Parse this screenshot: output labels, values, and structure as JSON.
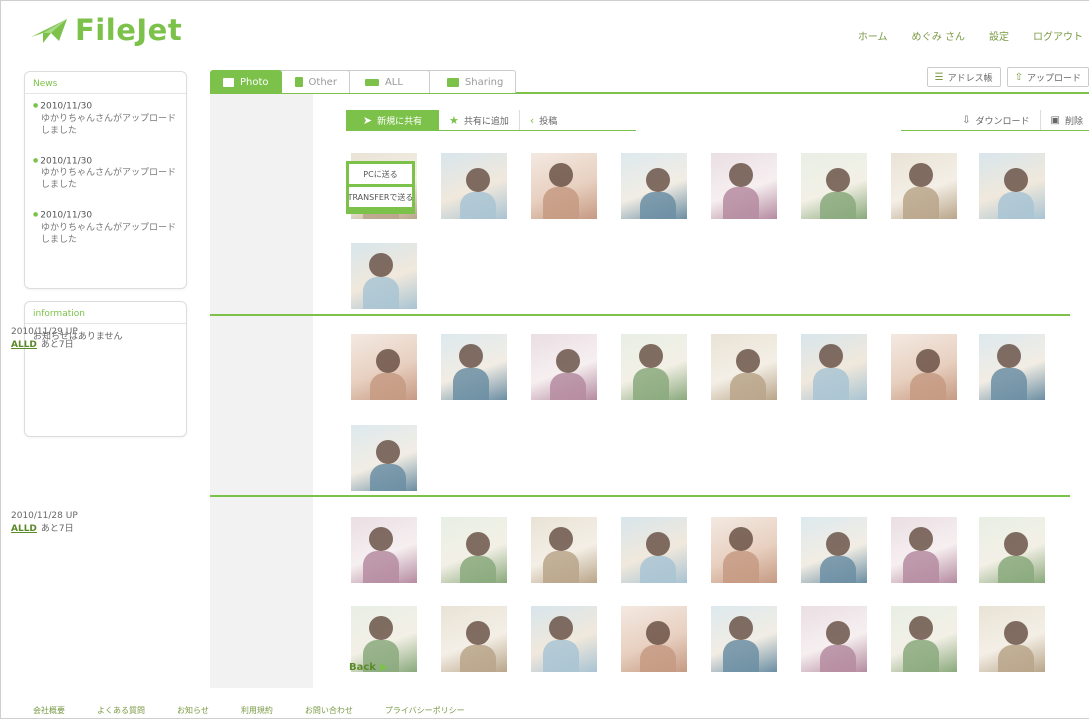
{
  "header": {
    "logo": "FileJet",
    "nav": [
      "ホーム",
      "めぐみ さん",
      "設定",
      "ログアウト"
    ]
  },
  "sidebar": {
    "news_title": "News",
    "news": [
      {
        "date": "2010/11/30",
        "text": "ゆかりちゃんさんがアップロードしました"
      },
      {
        "date": "2010/11/30",
        "text": "ゆかりちゃんさんがアップロードしました"
      },
      {
        "date": "2010/11/30",
        "text": "ゆかりちゃんさんがアップロードしました"
      }
    ],
    "info_title": "information",
    "info_text": "お知らせはありません"
  },
  "tabs": [
    {
      "label": "Photo",
      "active": true
    },
    {
      "label": "Other",
      "active": false
    },
    {
      "label": "ALL",
      "active": false
    },
    {
      "label": "Sharing",
      "active": false
    }
  ],
  "top_buttons": {
    "address": "アドレス帳",
    "upload": "アップロード"
  },
  "toolbar": {
    "new": "新規に共有",
    "add": "共有に追加",
    "post": "投稿",
    "download": "ダウンロード",
    "delete": "削除"
  },
  "dropdown": {
    "pc": "PCに送る",
    "transfer": "TRANSFERで送る"
  },
  "sections": [
    {
      "date": "",
      "all": "",
      "remain": ""
    },
    {
      "date": "2010/11/29 UP",
      "all": "ALLD",
      "remain": "あと7日"
    },
    {
      "date": "2010/11/28 UP",
      "all": "ALLD",
      "remain": "あと7日"
    }
  ],
  "back": "Back",
  "footer": [
    "会社概要",
    "よくある質問",
    "お知らせ",
    "利用規約",
    "お問い合わせ",
    "プライバシーポリシー"
  ],
  "colors": {
    "accent": "#7cc24a",
    "link": "#5a8a2a",
    "panel": "#f2f2f2"
  }
}
